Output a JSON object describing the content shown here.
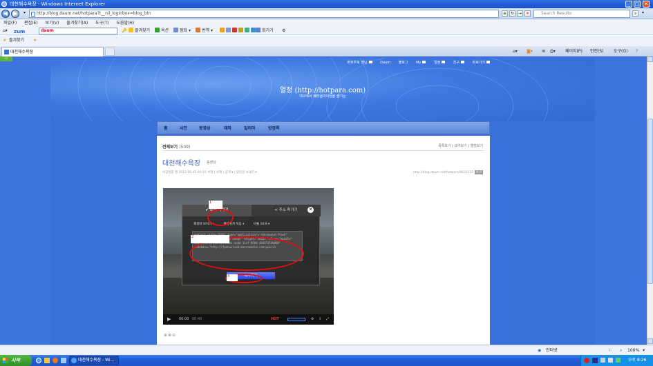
{
  "window": {
    "title": "대천해수욕장 - Windows Internet Explorer"
  },
  "address": {
    "url": "http://blog.daum.net/hotpara?t__nil_loginbox=blog_btn",
    "search_placeholder": "Search Resulto"
  },
  "menu": [
    "파일(F)",
    "편집(E)",
    "보기(V)",
    "즐겨찾기(A)",
    "도구(T)",
    "도움말(H)"
  ],
  "toolbar": {
    "brand": "zum",
    "search_value": "daum",
    "items": [
      "즐겨찾기",
      "옥션",
      "점좌",
      "번역",
      "회기기"
    ]
  },
  "favorites": {
    "label": "즐겨찾기"
  },
  "tab": {
    "label": "대천해수욕장"
  },
  "commands": {
    "page": "페이지(P)",
    "safety": "안전(S)",
    "tools": "도구(O)",
    "help": "?"
  },
  "blog": {
    "topnav": [
      "바로우로 멤닌",
      "Daum",
      "블로그",
      "My",
      "일정",
      "친구",
      "바로가기"
    ],
    "title": "열정 (http://hotpara.com)",
    "subtitle": "대구에서 패러글라이딩을 즐기는",
    "nav": [
      "홈",
      "사진",
      "동영상",
      "테마",
      "일러마",
      "방명록"
    ],
    "section": "전체보기",
    "section_count": "(509)",
    "right_links": "목록보기 | 요약보기 | 앨범보기",
    "post_title": "대천해수욕장",
    "post_category": "동영상",
    "meta": "비공성을 멘  2012.06.05 00:15  수정  |  삭제  |  공개 ▾  |  엮인글 보내기 ▾",
    "post_url": "http://blog.daum.net/hotpara/8621133",
    "post_url_badge": "복사",
    "bottom_icons": "⊕⊗⊖"
  },
  "video_dialog": {
    "tab_source": "소스 퍼가기",
    "tab_address": "주소 퍼가기",
    "opt1": "재생바 보이기 ▾",
    "opt2": "재생위치 처음 ▾",
    "opt3": "비율 16:9 ▾",
    "code": "<object width=\"640\" type=\"application/x-shockwave-flash\" id=\"vx1t2a4ep8\" width=\"640px\" height=\"360px\" align=\"middle\" classid=\"clsid:d27cdb6e-ae6d-11cf-96b8-444553540000\" codebase=\"http://fpdownload.macromedia.com/pub/sh",
    "copy_button": "복사하기",
    "close": "✕"
  },
  "player": {
    "current": "00:00",
    "total": "00:46",
    "hot": "HOT"
  },
  "annotations": {
    "a1": "1",
    "a2": "2",
    "a3": "3"
  },
  "status": {
    "zone": "인터넷",
    "zoom": "100%"
  },
  "taskbar": {
    "start": "시작",
    "task": "대천해수욕장 - Wi...",
    "time": "오후 8:26"
  },
  "colors": {
    "accent": "#3e74dd",
    "annotation": "#e01010",
    "copy_button": "#2b45e8"
  }
}
